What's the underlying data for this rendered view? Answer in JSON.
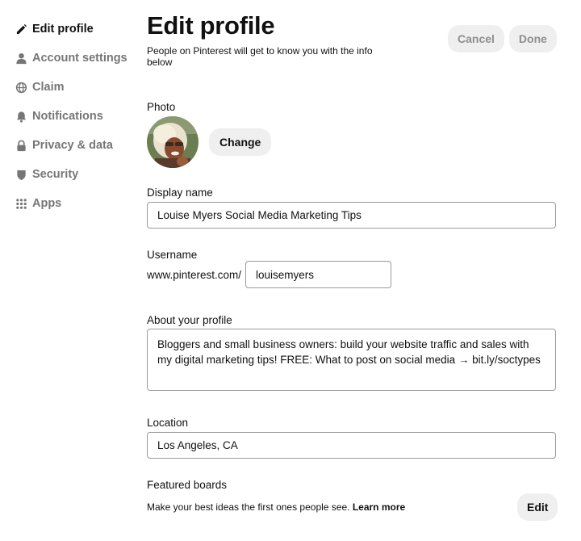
{
  "sidebar": {
    "items": [
      {
        "label": "Edit profile",
        "icon": "pencil-icon",
        "active": true
      },
      {
        "label": "Account settings",
        "icon": "person-icon",
        "active": false
      },
      {
        "label": "Claim",
        "icon": "globe-icon",
        "active": false
      },
      {
        "label": "Notifications",
        "icon": "bell-icon",
        "active": false
      },
      {
        "label": "Privacy & data",
        "icon": "lock-icon",
        "active": false
      },
      {
        "label": "Security",
        "icon": "shield-icon",
        "active": false
      },
      {
        "label": "Apps",
        "icon": "grid-icon",
        "active": false
      }
    ]
  },
  "header": {
    "title": "Edit profile",
    "subtitle": "People on Pinterest will get to know you with the info below",
    "cancel_label": "Cancel",
    "done_label": "Done"
  },
  "photo": {
    "label": "Photo",
    "change_label": "Change"
  },
  "display_name": {
    "label": "Display name",
    "value": "Louise Myers Social Media Marketing Tips"
  },
  "username": {
    "label": "Username",
    "prefix": "www.pinterest.com/",
    "value": "louisemyers"
  },
  "about": {
    "label": "About your profile",
    "value": "Bloggers and small business owners: build your website traffic and sales with my digital marketing tips! FREE: What to post on social media → bit.ly/soctypes"
  },
  "location": {
    "label": "Location",
    "value": "Los Angeles, CA"
  },
  "featured": {
    "label": "Featured boards",
    "description": "Make your best ideas the first ones people see.",
    "learn_more": "Learn more",
    "edit_label": "Edit"
  },
  "colors": {
    "active_text": "#111111",
    "inactive_text": "#767676",
    "button_bg": "#efefef",
    "input_border": "#9a9a9a"
  }
}
